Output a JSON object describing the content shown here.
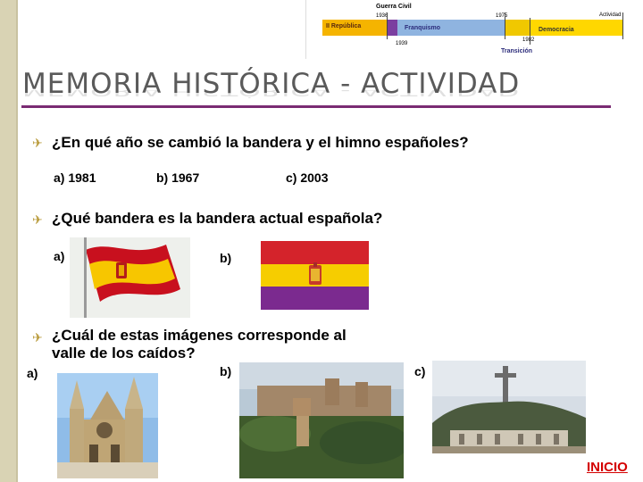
{
  "timeline": {
    "top_label": "Guerra Civil",
    "right_label": "Actividad",
    "years": [
      "1936",
      "1939",
      "1975",
      "1982"
    ],
    "segments": [
      {
        "label": "II República",
        "color": "#f5b400"
      },
      {
        "label": "Franquismo",
        "color": "#7b3fa0"
      },
      {
        "label": "Democracia",
        "color": "#8fb4e0"
      }
    ],
    "bottom_label": "Transición"
  },
  "title": "MEMORIA HISTÓRICA - ACTIVIDAD",
  "questions": [
    {
      "text": "¿En qué año se cambió la bandera y el himno españoles?",
      "options": [
        "a) 1981",
        "b) 1967",
        "c) 2003"
      ]
    },
    {
      "text": "¿Qué bandera es la bandera actual española?",
      "options": [
        "a)",
        "b)"
      ]
    },
    {
      "text_line1": "¿Cuál de estas imágenes corresponde al",
      "text_line2": "valle de los caídos?",
      "options": [
        "a)",
        "b)",
        "c)"
      ]
    }
  ],
  "bullet_glyph": "✈",
  "inicio_link": "INICIO",
  "colors": {
    "accent": "#7a2b73",
    "link": "#d40000",
    "sidebar": "#d9d3b4"
  }
}
